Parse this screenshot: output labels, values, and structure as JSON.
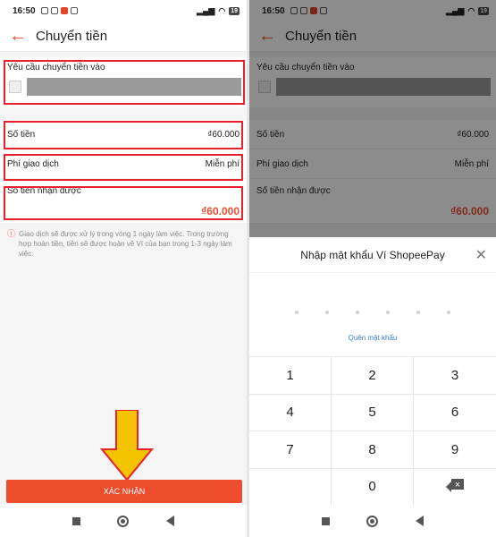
{
  "status": {
    "time": "16:50",
    "battery": "19"
  },
  "header": {
    "title": "Chuyển tiền",
    "back_icon": "arrow-left-icon"
  },
  "request": {
    "label": "Yêu cầu chuyển tiền vào"
  },
  "amount": {
    "label": "Số tiền",
    "value": "₫60.000"
  },
  "fee": {
    "label": "Phí giao dịch",
    "value": "Miễn phí"
  },
  "received": {
    "label": "Số tiền nhận được",
    "value": "₫60.000"
  },
  "note": {
    "text": "Giao dịch sẽ được xử lý trong vòng 1 ngày làm việc. Trong trường hợp hoàn tiền, tiền sẽ được hoàn về Ví của bạn trong 1-3 ngày làm việc."
  },
  "confirm_button": {
    "label": "XÁC NHẬN"
  },
  "password_sheet": {
    "title": "Nhập mật khẩu Ví ShopeePay",
    "forgot": "Quên mật khẩu",
    "keys": [
      "1",
      "2",
      "3",
      "4",
      "5",
      "6",
      "7",
      "8",
      "9",
      "",
      "0",
      ""
    ]
  },
  "colors": {
    "accent": "#ee4d2d",
    "highlight": "#e8212c",
    "arrow": "#f5c400"
  }
}
